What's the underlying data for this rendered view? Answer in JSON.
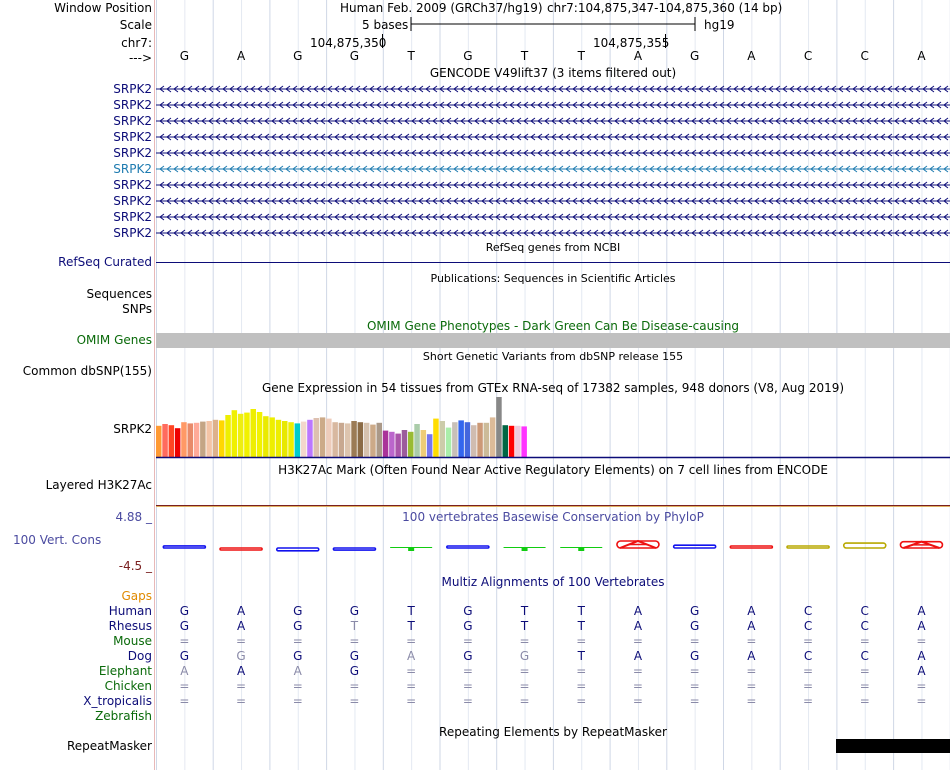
{
  "header": {
    "window_position_label": "Window Position",
    "assembly": "Human Feb. 2009 (GRCh37/hg19)",
    "position": "chr7:104,875,347-104,875,360 (14 bp)",
    "scale_label": "Scale",
    "scale_text": "5 bases",
    "scale_db": "hg19",
    "chrom_label": "chr7:",
    "ticks": [
      "104,875,350",
      "104,875,355"
    ],
    "strand_label": "--->"
  },
  "bases": [
    "G",
    "A",
    "G",
    "G",
    "T",
    "G",
    "T",
    "T",
    "A",
    "G",
    "A",
    "C",
    "C",
    "A"
  ],
  "gencode": {
    "title": "GENCODE V49lift37 (3 items filtered out)",
    "items": [
      "SRPK2",
      "SRPK2",
      "SRPK2",
      "SRPK2",
      "SRPK2",
      "SRPK2",
      "SRPK2",
      "SRPK2",
      "SRPK2",
      "SRPK2"
    ],
    "highlight_index": 5,
    "color": "#0c0c78",
    "highlight_color": "#1e7bb0"
  },
  "refseq": {
    "title": "RefSeq genes from NCBI",
    "label": "RefSeq Curated",
    "color": "#0c0c78"
  },
  "publications": {
    "title": "Publications: Sequences in Scientific Articles",
    "labels": [
      "Sequences",
      "SNPs"
    ]
  },
  "omim": {
    "title": "OMIM Gene Phenotypes - Dark Green Can Be Disease-causing",
    "label": "OMIM Genes",
    "color": "#0a6a0a",
    "bar_color": "#c0c0c0"
  },
  "dbsnp": {
    "title": "Short Genetic Variants from dbSNP release 155",
    "label": "Common dbSNP(155)"
  },
  "gtex": {
    "title": "Gene Expression in 54 tissues from GTEx RNA-seq of 17382 samples, 948 donors (V8, Aug 2019)",
    "label": "SRPK2",
    "values": [
      0.52,
      0.55,
      0.53,
      0.48,
      0.58,
      0.56,
      0.57,
      0.59,
      0.6,
      0.62,
      0.61,
      0.7,
      0.78,
      0.72,
      0.74,
      0.8,
      0.75,
      0.68,
      0.66,
      0.62,
      0.6,
      0.58,
      0.56,
      0.59,
      0.62,
      0.65,
      0.66,
      0.64,
      0.58,
      0.57,
      0.56,
      0.6,
      0.58,
      0.57,
      0.54,
      0.57,
      0.44,
      0.42,
      0.39,
      0.45,
      0.42,
      0.55,
      0.45,
      0.38,
      0.64,
      0.6,
      0.49,
      0.58,
      0.61,
      0.58,
      0.53,
      0.57,
      0.57,
      0.66,
      1.0,
      0.53,
      0.52,
      0.52,
      0.51
    ],
    "colors": [
      "#ff9933",
      "#ff6b5e",
      "#ff4422",
      "#ee0000",
      "#ff9966",
      "#e88a6a",
      "#ffaa99",
      "#c4a585",
      "#f4c4a6",
      "#ddb18c",
      "#ffd700",
      "#eeee00",
      "#f0f000",
      "#eeee11",
      "#f1f100",
      "#eeee00",
      "#f2f200",
      "#eaea00",
      "#eeee00",
      "#eeee00",
      "#e8e800",
      "#eeee00",
      "#00cccc",
      "#f3d7cc",
      "#bb77ff",
      "#ddc0b0",
      "#ccaa88",
      "#eeccbb",
      "#d8b8a0",
      "#c8a890",
      "#ddc4ae",
      "#9b7b55",
      "#8b6b45",
      "#d6c2ae",
      "#ccaa88",
      "#aa9988",
      "#aa3399",
      "#bb66cc",
      "#aa55aa",
      "#9c5c9c",
      "#99bb33",
      "#aaccaa",
      "#eecc77",
      "#7777ee",
      "#ffdd00",
      "#ccccaa",
      "#aaeeaa",
      "#c8c0b8",
      "#3366ee",
      "#4466dd",
      "#d0bcb0",
      "#cc9977",
      "#ccbb99",
      "#ddbb99",
      "#888888",
      "#006644",
      "#ff0000",
      "#eeccdd",
      "#ff33ff"
    ],
    "baseline_color": "#0c0c78"
  },
  "h3k27ac": {
    "title": "H3K27Ac Mark (Often Found Near Active Regulatory Elements) on 7 cell lines from ENCODE",
    "label": "Layered H3K27Ac"
  },
  "phylop": {
    "title": "100 vertebrates Basewise Conservation by PhyloP",
    "label": "100 Vert. Cons",
    "max_label": "4.88 _",
    "min_label": "-4.5 _",
    "scores": [
      0.3,
      -0.2,
      -0.4,
      -0.3,
      -0.2,
      0,
      -0.5,
      0.2,
      1.0,
      0.4,
      0,
      0,
      0.7,
      0.9
    ],
    "base_colors": {
      "A": "#ee1111",
      "C": "#b8a800",
      "G": "#1111ee",
      "T": "#11cc11"
    }
  },
  "multiz": {
    "title": "Multiz Alignments of 100 Vertebrates",
    "gaps_label": "Gaps",
    "species": [
      {
        "name": "Human",
        "color": "#0c0c78",
        "bases": [
          "G",
          "A",
          "G",
          "G",
          "T",
          "G",
          "T",
          "T",
          "A",
          "G",
          "A",
          "C",
          "C",
          "A"
        ],
        "faded": [
          0,
          0,
          0,
          0,
          0,
          0,
          0,
          0,
          0,
          0,
          0,
          0,
          0,
          0
        ]
      },
      {
        "name": "Rhesus",
        "color": "#0c0c78",
        "bases": [
          "G",
          "A",
          "G",
          "T",
          "T",
          "G",
          "T",
          "T",
          "A",
          "G",
          "A",
          "C",
          "C",
          "A"
        ],
        "faded": [
          0,
          0,
          0,
          1,
          0,
          0,
          0,
          0,
          0,
          0,
          0,
          0,
          0,
          0
        ]
      },
      {
        "name": "Mouse",
        "color": "#0a6a0a",
        "bases": [
          "=",
          "=",
          "=",
          "=",
          "=",
          "=",
          "=",
          "=",
          "=",
          "=",
          "=",
          "=",
          "=",
          "="
        ],
        "faded": [
          1,
          1,
          1,
          1,
          1,
          1,
          1,
          1,
          1,
          1,
          1,
          1,
          1,
          1
        ]
      },
      {
        "name": "Dog",
        "color": "#0c0c78",
        "bases": [
          "G",
          "G",
          "G",
          "G",
          "A",
          "G",
          "G",
          "T",
          "A",
          "G",
          "A",
          "C",
          "C",
          "A"
        ],
        "faded": [
          0,
          1,
          0,
          0,
          1,
          0,
          1,
          0,
          0,
          0,
          0,
          0,
          0,
          0
        ]
      },
      {
        "name": "Elephant",
        "color": "#0a6a0a",
        "bases": [
          "A",
          "A",
          "A",
          "G",
          "=",
          "=",
          "=",
          "=",
          "=",
          "=",
          "=",
          "=",
          "=",
          "A"
        ],
        "faded": [
          1,
          0,
          1,
          0,
          1,
          1,
          1,
          1,
          1,
          1,
          1,
          1,
          1,
          0
        ]
      },
      {
        "name": "Chicken",
        "color": "#0a6a0a",
        "bases": [
          "=",
          "=",
          "=",
          "=",
          "=",
          "=",
          "=",
          "=",
          "=",
          "=",
          "=",
          "=",
          "=",
          "="
        ],
        "faded": [
          1,
          1,
          1,
          1,
          1,
          1,
          1,
          1,
          1,
          1,
          1,
          1,
          1,
          1
        ]
      },
      {
        "name": "X_tropicalis",
        "color": "#0c0c78",
        "bases": [
          "=",
          "=",
          "=",
          "=",
          "=",
          "=",
          "=",
          "=",
          "=",
          "=",
          "=",
          "=",
          "=",
          "="
        ],
        "faded": [
          1,
          1,
          1,
          1,
          1,
          1,
          1,
          1,
          1,
          1,
          1,
          1,
          1,
          1
        ]
      },
      {
        "name": "Zebrafish",
        "color": "#0a6a0a",
        "bases": [
          "",
          "",
          "",
          "",
          "",
          "",
          "",
          "",
          "",
          "",
          "",
          "",
          "",
          ""
        ],
        "faded": [
          0,
          0,
          0,
          0,
          0,
          0,
          0,
          0,
          0,
          0,
          0,
          0,
          0,
          0
        ]
      }
    ]
  },
  "repeatmasker": {
    "title": "Repeating Elements by RepeatMasker",
    "label": "RepeatMasker"
  },
  "colors": {
    "navy": "#0c0c78",
    "green": "#0a6a0a",
    "phylop": "#4a4aa0",
    "orange": "#e08a00",
    "grid": "#cfd7e6",
    "separator": "#e8b8b8"
  }
}
